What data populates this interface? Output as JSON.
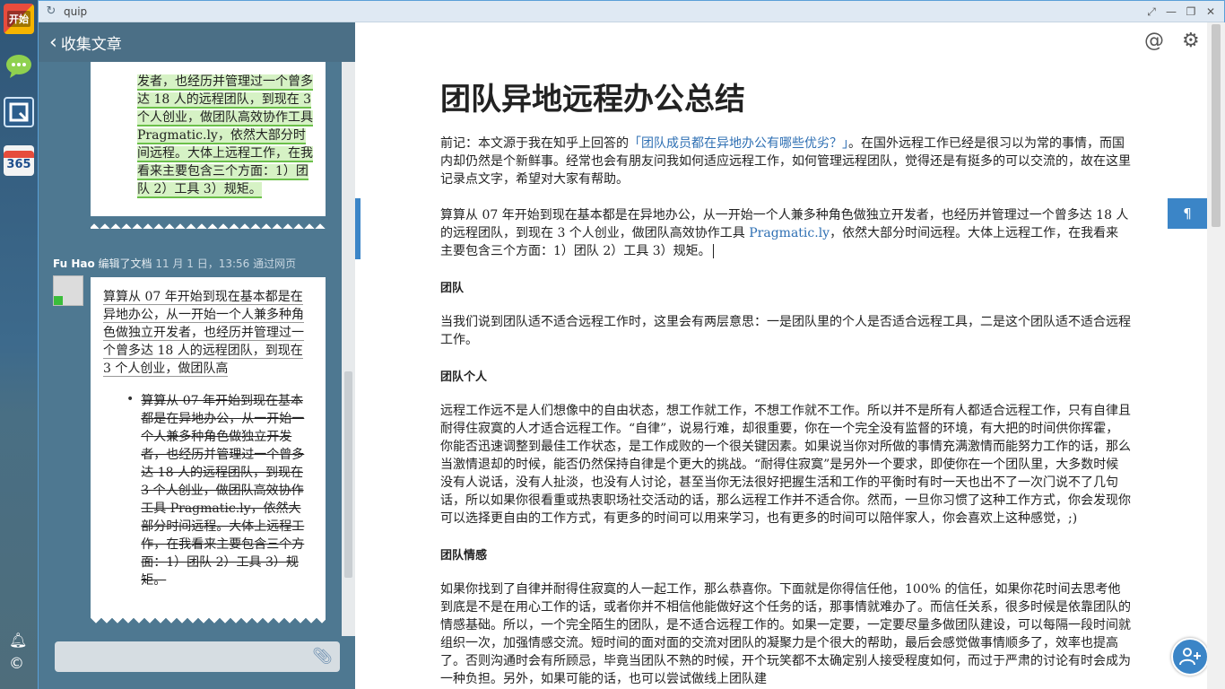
{
  "dock": {
    "start_label": "开始",
    "cal_label": "365"
  },
  "window": {
    "title": "quip"
  },
  "left": {
    "back_label": "收集文章",
    "card1_text": "发者，也经历并管理过一个曾多达 18 人的远程团队，到现在 3 个人创业，做团队高效协作工具 Pragmatic.ly，依然大部分时间远程。大体上远程工作，在我看来主要包含三个方面：1）团队 2）工具 3）规矩。",
    "activity_who": "Fu Hao",
    "activity_action": " 编辑了文档 ",
    "activity_when": "11 月 1 日，13:56 通过网页",
    "card2_text": "算算从 07 年开始到现在基本都是在异地办公，从一开始一个人兼多种角色做独立开发者，也经历并管理过一个曾多达 18 人的远程团队，到现在 3 个人创业，做团队高",
    "card2_struck": "算算从 07 年开始到现在基本都是在异地办公，从一开始一个人兼多种角色做独立开发者，也经历并管理过一个曾多达 18 人的远程团队，到现在 3 个人创业，做团队高效协作工具 Pragmatic.ly，依然大部分时间远程。大体上远程工作，在我看来主要包含三个方面：1）团队 2）工具 3）规矩。"
  },
  "doc": {
    "title": "团队异地远程办公总结",
    "intro_before": "前记：本文源于我在知乎上回答的",
    "intro_link": "「团队成员都在异地办公有哪些优劣？」",
    "intro_after": "。在国外远程工作已经是很习以为常的事情，而国内却仍然是个新鲜事。经常也会有朋友问我如何适应远程工作，如何管理远程团队，觉得还是有挺多的可以交流的，故在这里记录点文字，希望对大家有帮助。",
    "p1_before": "算算从 07 年开始到现在基本都是在异地办公，从一开始一个人兼多种角色做独立开发者，也经历并管理过一个曾多达 18 人的远程团队，到现在 3 个人创业，做团队高效协作工具 ",
    "p1_link": "Pragmatic.ly",
    "p1_after": "，依然大部分时间远程。大体上远程工作，在我看来主要包含三个方面：1）团队 2）工具 3）规矩。",
    "h1": "团队",
    "p2": "当我们说到团队适不适合远程工作时，这里会有两层意思：一是团队里的个人是否适合远程工具，二是这个团队适不适合远程工作。",
    "h2": "团队个人",
    "p3": "远程工作远不是人们想像中的自由状态，想工作就工作，不想工作就不工作。所以并不是所有人都适合远程工作，只有自律且耐得住寂寞的人才适合远程工作。“自律”，说易行难，却很重要，你在一个完全没有监督的环境，有大把的时间供你挥霍，你能否迅速调整到最佳工作状态，是工作成败的一个很关键因素。如果说当你对所做的事情充满激情而能努力工作的话，那么当激情退却的时候，能否仍然保持自律是个更大的挑战。“耐得住寂寞”是另外一个要求，即使你在一个团队里，大多数时候没有人说话，没有人扯淡，也没有人讨论，甚至当你无法很好把握生活和工作的平衡时有时一天也出不了一次门说不了几句话，所以如果你很看重或热衷职场社交活动的话，那么远程工作并不适合你。然而，一旦你习惯了这种工作方式，你会发现你可以选择更自由的工作方式，有更多的时间可以用来学习，也有更多的时间可以陪伴家人，你会喜欢上这种感觉，;)",
    "h3": "团队情感",
    "p4": "如果你找到了自律并耐得住寂寞的人一起工作，那么恭喜你。下面就是你得信任他，100% 的信任，如果你花时间去思考他到底是不是在用心工作的话，或者你并不相信他能做好这个任务的话，那事情就难办了。而信任关系，很多时候是依靠团队的情感基础。所以，一个完全陌生的团队，是不适合远程工作的。如果一定要，一定要尽量多做团队建设，可以每隔一段时间就组织一次，加强情感交流。短时间的面对面的交流对团队的凝聚力是个很大的帮助，最后会感觉做事情顺多了，效率也提高了。否则沟通时会有所顾忌，毕竟当团队不熟的时候，开个玩笑都不太确定别人接受程度如何，而过于严肃的讨论有时会成为一种负担。另外，如果可能的话，也可以尝试做线上团队建"
  },
  "icons": {
    "para_mark": "¶",
    "at": "@",
    "gear": "⚙"
  }
}
